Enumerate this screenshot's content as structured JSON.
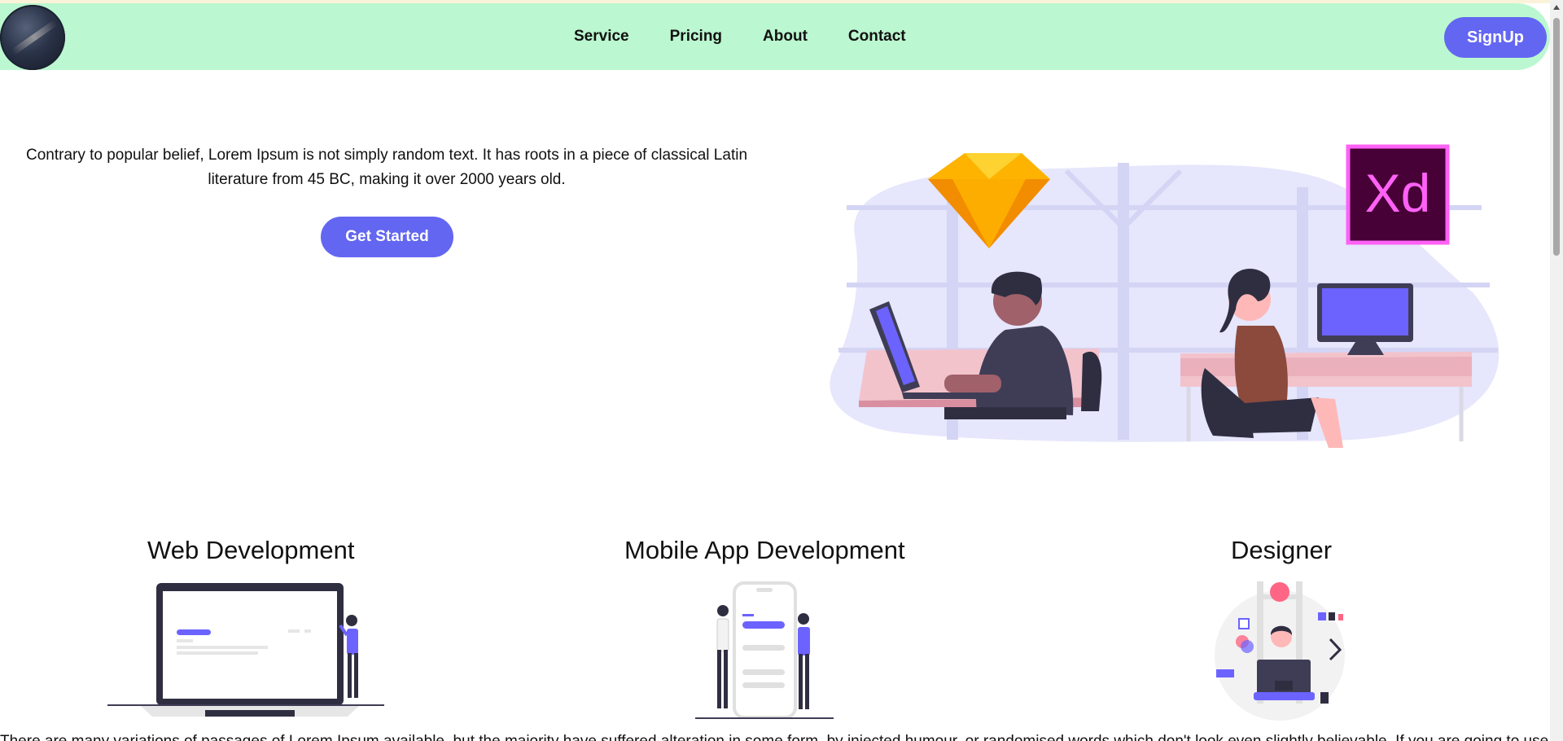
{
  "nav": {
    "links": [
      "Service",
      "Pricing",
      "About",
      "Contact"
    ],
    "signup_label": "SignUp"
  },
  "hero": {
    "text": "Contrary to popular belief, Lorem Ipsum is not simply random text. It has roots in a piece of classical Latin literature from 45 BC, making it over 2000 years old.",
    "cta_label": "Get Started",
    "badge_text": "Xd"
  },
  "services": {
    "web_title": "Web Development",
    "mobile_title": "Mobile App Development",
    "designer_title": "Designer"
  },
  "footer_text": "There are many variations of passages of Lorem Ipsum available, but the majority have suffered alteration in some form, by injected humour, or randomised words which don't look even slightly believable. If you are going to use a passage of Lorem Ipsum, you need to be sure there isn't anything embarrassing hidden in the middle of text.",
  "colors": {
    "navbar_bg": "#bbf7d0",
    "accent": "#6366f1",
    "xd_pink": "#ff61f6",
    "sketch_yellow": "#fdb300"
  }
}
